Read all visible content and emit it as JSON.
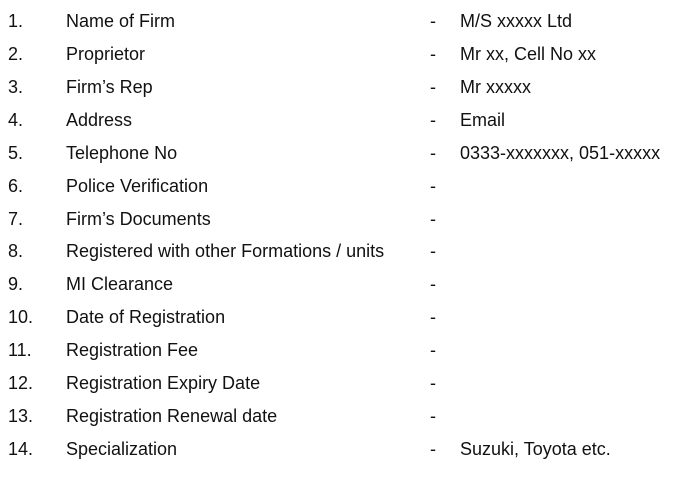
{
  "rows": [
    {
      "num": "1.",
      "label": "Name of Firm",
      "sep": "-",
      "value": "M/S xxxxx Ltd"
    },
    {
      "num": "2.",
      "label": "Proprietor",
      "sep": "-",
      "value": "Mr xx, Cell No xx"
    },
    {
      "num": "3.",
      "label": "Firm’s Rep",
      "sep": "-",
      "value": "Mr xxxxx"
    },
    {
      "num": "4.",
      "label": "Address",
      "sep": "-",
      "value": "Email"
    },
    {
      "num": "5.",
      "label": "Telephone No",
      "sep": "-",
      "value": "0333-xxxxxxx, 051-xxxxx"
    },
    {
      "num": "6.",
      "label": "Police Verification",
      "sep": "-",
      "value": ""
    },
    {
      "num": "7.",
      "label": "Firm’s Documents",
      "sep": "-",
      "value": ""
    },
    {
      "num": "8.",
      "label": "Registered with other Formations / units",
      "sep": "-",
      "value": ""
    },
    {
      "num": "9.",
      "label": "MI Clearance",
      "sep": "-",
      "value": ""
    },
    {
      "num": "10.",
      "label": "Date of Registration",
      "sep": "-",
      "value": ""
    },
    {
      "num": "11.",
      "label": "Registration Fee",
      "sep": "-",
      "value": ""
    },
    {
      "num": "12.",
      "label": "Registration Expiry Date",
      "sep": "-",
      "value": ""
    },
    {
      "num": "13.",
      "label": "Registration Renewal date",
      "sep": "-",
      "value": ""
    },
    {
      "num": "14.",
      "label": "Specialization",
      "sep": "-",
      "value": "Suzuki, Toyota etc."
    }
  ]
}
